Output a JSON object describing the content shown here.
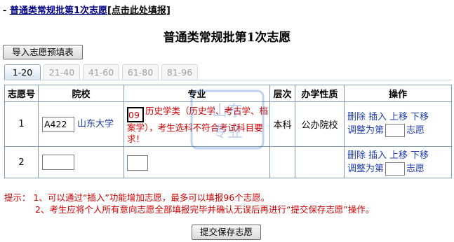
{
  "header": {
    "dash": "-",
    "title": "普通类常规批第1次志愿",
    "fill_link": "[点击此处填报]"
  },
  "page_title": "普通类常规批第1次志愿",
  "import_button": "导入志愿预填表",
  "tabs": [
    {
      "label": "1-20",
      "active": true
    },
    {
      "label": "21-40",
      "active": false
    },
    {
      "label": "41-60",
      "active": false
    },
    {
      "label": "61-80",
      "active": false
    },
    {
      "label": "81-96",
      "active": false
    }
  ],
  "table": {
    "headers": [
      "志愿号",
      "院校",
      "专业",
      "层次",
      "办学性质",
      "操作"
    ],
    "rows": [
      {
        "no": "1",
        "school_code": "A422",
        "school_name": "山东大学",
        "major_code": "09",
        "major_desc": "历史学类（历史学、考古学、档案学），考生选科不符合考试科目要求！",
        "level": "本科",
        "nature": "公办院校",
        "ops": {
          "delete": "删除",
          "insert": "插入",
          "up": "上移",
          "down": "下移",
          "adjust_prefix": "调整为第",
          "adjust_suffix": "志愿"
        }
      },
      {
        "no": "2",
        "school_code": "",
        "school_name": "",
        "major_code": "",
        "major_desc": "",
        "level": "",
        "nature": "",
        "ops": {
          "delete": "删除",
          "insert": "插入",
          "up": "上移",
          "down": "下移",
          "adjust_prefix": "调整为第",
          "adjust_suffix": "志愿"
        }
      }
    ]
  },
  "tips": {
    "prefix": "提示：",
    "line1": "1、可以通过“插入”功能增加志愿，最多可以填报96个志愿。",
    "line2": "2、考生应将个人所有意向志愿全部填报完毕并确认无误后再进行“提交保存志愿”操作。"
  },
  "submit_button": "提交保存志愿",
  "watermark": {
    "line1": "山东",
    "line2": "专业"
  },
  "colors": {
    "link": "#1f3fb0",
    "warning": "#cc0000",
    "border": "#7f9db9",
    "title_link": "#000080"
  }
}
